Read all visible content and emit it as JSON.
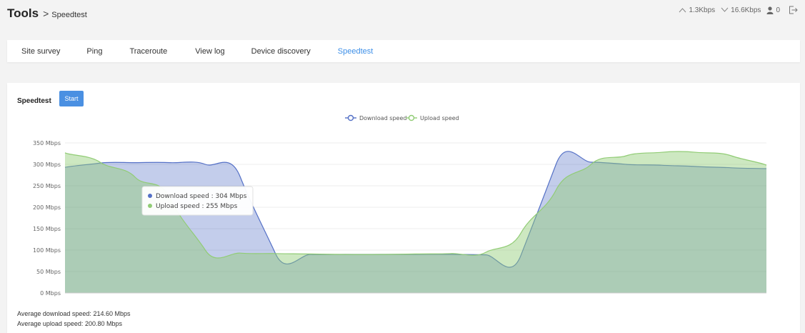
{
  "header": {
    "title": "Tools",
    "separator": ">",
    "subtitle": "Speedtest",
    "upload_rate": "1.3Kbps",
    "download_rate": "16.6Kbps",
    "user_count": "0",
    "icons": [
      "arrow-up-icon",
      "arrow-down-icon",
      "user-icon",
      "logout-icon"
    ]
  },
  "tabs": [
    {
      "label": "Site survey",
      "active": false
    },
    {
      "label": "Ping",
      "active": false
    },
    {
      "label": "Traceroute",
      "active": false
    },
    {
      "label": "View log",
      "active": false
    },
    {
      "label": "Device discovery",
      "active": false
    },
    {
      "label": "Speedtest",
      "active": true
    }
  ],
  "panel": {
    "title": "Speedtest",
    "start_label": "Start",
    "avg_download_label": "Average download speed:",
    "avg_download_value": "214.60 Mbps",
    "avg_upload_label": "Average upload speed:",
    "avg_upload_value": "200.80 Mbps"
  },
  "colors": {
    "accent": "#3d8fe8",
    "button": "#4a90e2",
    "download": "#5470c6",
    "upload": "#91cc75"
  },
  "chart_data": {
    "type": "area",
    "title": "",
    "xlabel": "",
    "ylabel": "",
    "ylim": [
      0,
      350
    ],
    "yticks": [
      "0 Mbps",
      "50 Mbps",
      "100 Mbps",
      "150 Mbps",
      "200 Mbps",
      "250 Mbps",
      "300 Mbps",
      "350 Mbps"
    ],
    "grid": true,
    "legend_position": "top-center",
    "x": [
      0,
      1,
      2,
      3,
      4,
      5,
      6,
      7,
      8,
      9,
      10,
      11,
      12,
      13,
      14,
      15,
      16,
      17,
      18,
      19,
      20
    ],
    "series": [
      {
        "name": "Download speed",
        "color": "#5470c6",
        "values": [
          293,
          303,
          304,
          304,
          300,
          270,
          92,
          90,
          90,
          90,
          90,
          90,
          89,
          88,
          300,
          305,
          300,
          298,
          295,
          292,
          290
        ]
      },
      {
        "name": "Upload speed",
        "color": "#91cc75",
        "values": [
          327,
          305,
          270,
          220,
          100,
          93,
          92,
          91,
          90,
          90,
          91,
          92,
          95,
          140,
          240,
          300,
          320,
          328,
          328,
          320,
          298
        ]
      }
    ],
    "tooltip": {
      "index": 3,
      "lines": [
        "Download speed : 304 Mbps",
        "Upload speed : 255 Mbps"
      ]
    }
  }
}
